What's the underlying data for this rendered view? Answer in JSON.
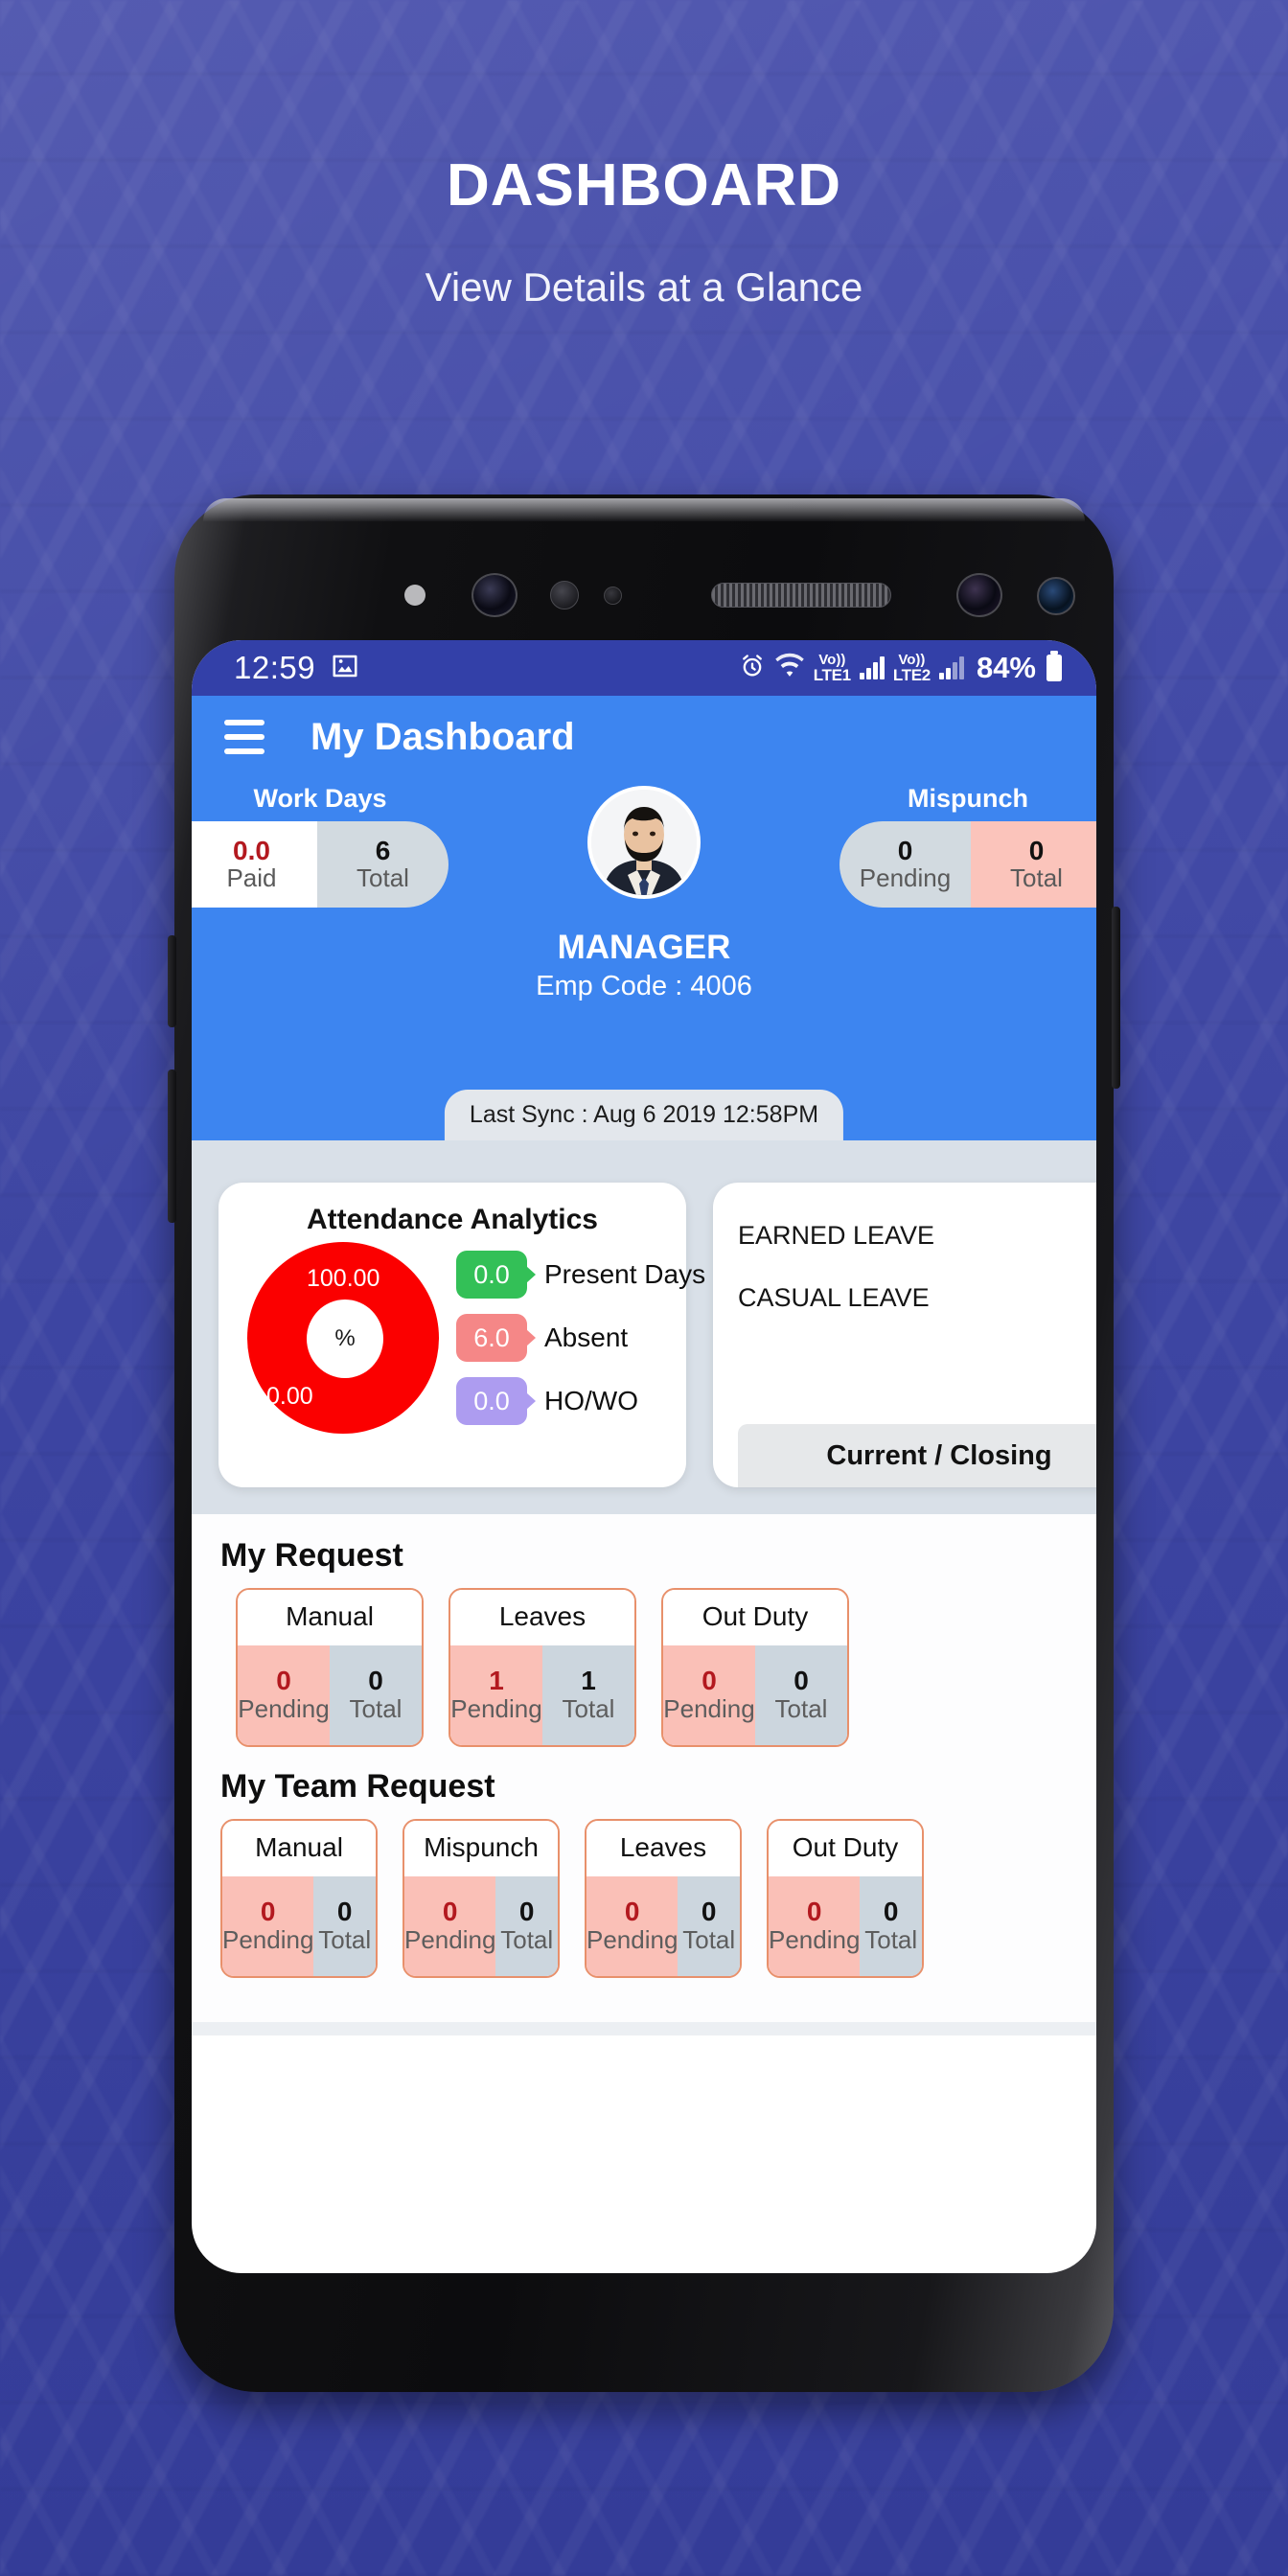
{
  "promo": {
    "title": "DASHBOARD",
    "subtitle": "View Details at a Glance"
  },
  "statusbar": {
    "time": "12:59",
    "image_icon": "image-icon",
    "alarm_icon": "alarm-icon",
    "wifi_icon": "wifi-icon",
    "sim1_label_top": "Vo))",
    "sim1_label_bottom": "LTE1",
    "sim2_label_top": "Vo))",
    "sim2_label_bottom": "LTE2",
    "battery_percent": "84%",
    "battery_icon": "battery-icon"
  },
  "appbar": {
    "menu_icon": "hamburger-menu-icon",
    "title": "My Dashboard"
  },
  "hero": {
    "work_days": {
      "title": "Work Days",
      "cells": [
        {
          "value": "0.0",
          "label": "Paid"
        },
        {
          "value": "6",
          "label": "Total"
        }
      ]
    },
    "mispunch": {
      "title": "Mispunch",
      "cells": [
        {
          "value": "0",
          "label": "Pending"
        },
        {
          "value": "0",
          "label": "Total"
        }
      ]
    },
    "avatar": "user-avatar",
    "name": "MANAGER",
    "emp_code": "Emp Code : 4006",
    "last_sync": "Last Sync : Aug  6 2019 12:58PM"
  },
  "analytics_card": {
    "title": "Attendance Analytics",
    "center_label": "%",
    "top_value": "100.00",
    "bottom_value": "0.00",
    "legend": [
      {
        "value": "0.0",
        "label": "Present Days",
        "color": "#33c057"
      },
      {
        "value": "6.0",
        "label": "Absent",
        "color": "#f58787"
      },
      {
        "value": "0.0",
        "label": "HO/WO",
        "color": "#ad9cf0"
      }
    ]
  },
  "leave_card": {
    "lines": [
      "EARNED LEAVE",
      "CASUAL LEAVE"
    ],
    "button": "Current / Closing"
  },
  "my_request": {
    "title": "My Request",
    "cards": [
      {
        "name": "Manual",
        "pending": "0",
        "pending_label": "Pending",
        "total": "0",
        "total_label": "Total"
      },
      {
        "name": "Leaves",
        "pending": "1",
        "pending_label": "Pending",
        "total": "1",
        "total_label": "Total"
      },
      {
        "name": "Out Duty",
        "pending": "0",
        "pending_label": "Pending",
        "total": "0",
        "total_label": "Total"
      }
    ]
  },
  "my_team_request": {
    "title": "My Team Request",
    "cards": [
      {
        "name": "Manual",
        "pending": "0",
        "pending_label": "Pending",
        "total": "0",
        "total_label": "Total"
      },
      {
        "name": "Mispunch",
        "pending": "0",
        "pending_label": "Pending",
        "total": "0",
        "total_label": "Total"
      },
      {
        "name": "Leaves",
        "pending": "0",
        "pending_label": "Pending",
        "total": "0",
        "total_label": "Total"
      },
      {
        "name": "Out Duty",
        "pending": "0",
        "pending_label": "Pending",
        "total": "0",
        "total_label": "Total"
      }
    ]
  },
  "chart_data": {
    "type": "pie",
    "title": "Attendance Analytics",
    "categories": [
      "Present Days",
      "Absent",
      "HO/WO"
    ],
    "values": [
      0.0,
      6.0,
      0.0
    ],
    "percentages": [
      0.0,
      100.0,
      0.0
    ],
    "colors": [
      "#33c057",
      "#fb0000",
      "#ad9cf0"
    ],
    "labels_on_chart": [
      "100.00",
      "0.00"
    ],
    "center_label": "%",
    "legend_position": "right",
    "grid": false
  },
  "colors": {
    "promo_bg": "#3e46a2",
    "appbar": "#3d85f0",
    "statusbar": "#3340a8",
    "band": "#d9e0e8",
    "pink": "#fbc4bb",
    "grey": "#d2dae0",
    "donut_red": "#fb0000",
    "card_border": "#e8906b"
  }
}
